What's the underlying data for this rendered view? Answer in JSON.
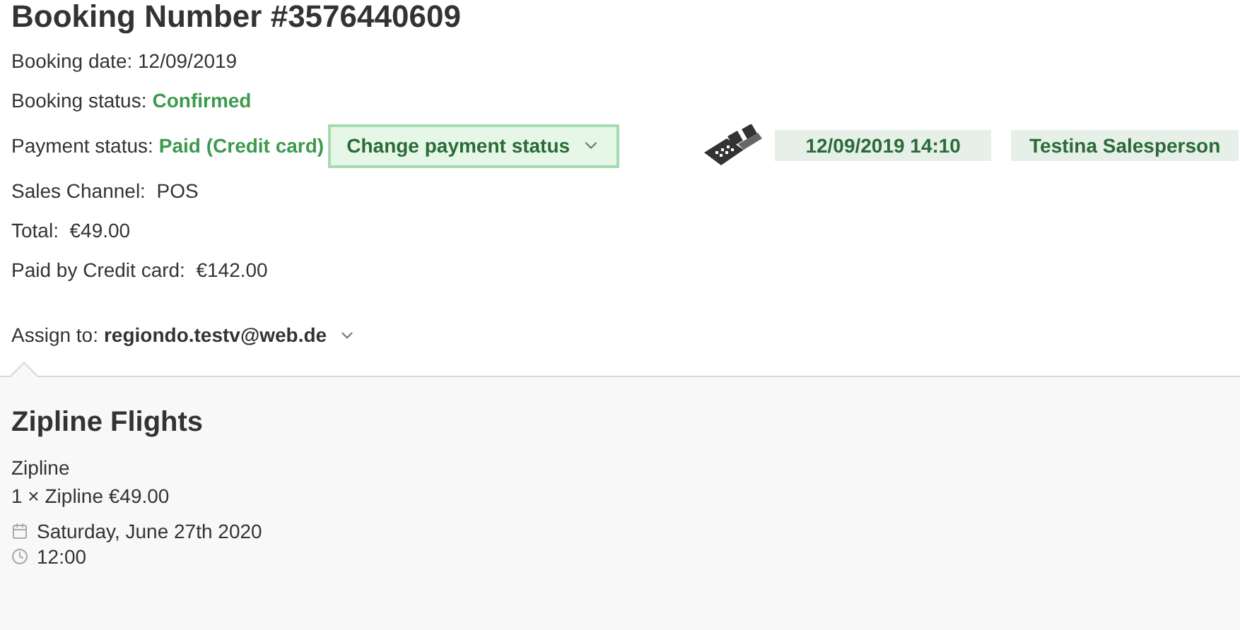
{
  "title": "Booking Number #3576440609",
  "booking_date": {
    "label": "Booking date:",
    "value": "12/09/2019"
  },
  "booking_status": {
    "label": "Booking status:",
    "value": "Confirmed"
  },
  "payment_status": {
    "label": "Payment status:",
    "value": "Paid (Credit card)",
    "button": "Change payment status"
  },
  "pos": {
    "date_time": "12/09/2019 14:10",
    "salesperson": "Testina Salesperson"
  },
  "details": [
    {
      "label": "Sales Channel:",
      "value": "POS"
    },
    {
      "label": "Total:",
      "value": "€49.00"
    },
    {
      "label": "Paid by Credit card:",
      "value": "€142.00"
    }
  ],
  "assign_to": {
    "label": "Assign to:",
    "value": "regiondo.testv@web.de"
  },
  "product": {
    "title": "Zipline Flights",
    "option": "Zipline",
    "line": "1 × Zipline €49.00",
    "date": "Saturday, June 27th 2020",
    "time": "12:00"
  }
}
